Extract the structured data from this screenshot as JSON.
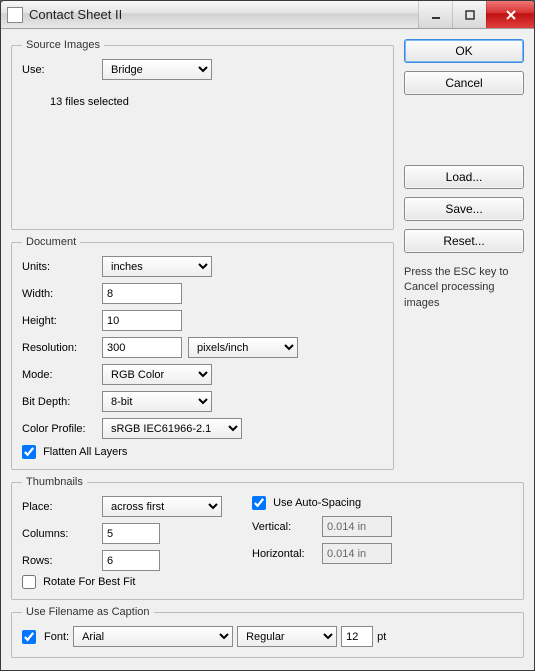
{
  "window": {
    "title": "Contact Sheet II"
  },
  "buttons": {
    "ok": "OK",
    "cancel": "Cancel",
    "load": "Load...",
    "save": "Save...",
    "reset": "Reset..."
  },
  "hint": "Press the ESC key to Cancel processing images",
  "source": {
    "legend": "Source Images",
    "use_label": "Use:",
    "use_value": "Bridge",
    "selected_text": "13 files selected"
  },
  "document": {
    "legend": "Document",
    "units_label": "Units:",
    "units_value": "inches",
    "width_label": "Width:",
    "width_value": "8",
    "height_label": "Height:",
    "height_value": "10",
    "resolution_label": "Resolution:",
    "resolution_value": "300",
    "resolution_unit": "pixels/inch",
    "mode_label": "Mode:",
    "mode_value": "RGB Color",
    "bitdepth_label": "Bit Depth:",
    "bitdepth_value": "8-bit",
    "profile_label": "Color Profile:",
    "profile_value": "sRGB IEC61966-2.1",
    "flatten_label": "Flatten All Layers"
  },
  "thumbnails": {
    "legend": "Thumbnails",
    "place_label": "Place:",
    "place_value": "across first",
    "columns_label": "Columns:",
    "columns_value": "5",
    "rows_label": "Rows:",
    "rows_value": "6",
    "rotate_label": "Rotate For Best Fit",
    "auto_label": "Use Auto-Spacing",
    "vertical_label": "Vertical:",
    "vertical_value": "0.014 in",
    "horizontal_label": "Horizontal:",
    "horizontal_value": "0.014 in"
  },
  "caption": {
    "legend": "Use Filename as Caption",
    "font_label": "Font:",
    "font_value": "Arial",
    "style_value": "Regular",
    "size_value": "12",
    "size_unit": "pt"
  }
}
